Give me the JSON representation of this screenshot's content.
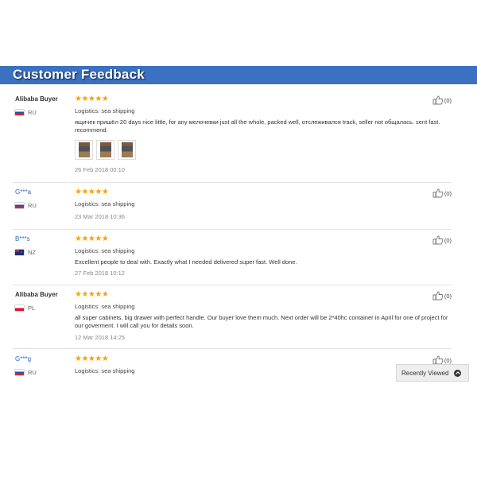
{
  "header": {
    "title": "Customer Feedback"
  },
  "colors": {
    "header_bg": "#3a71c0",
    "star": "#f5a400",
    "masked_name": "#2d6cc6"
  },
  "reviews": [
    {
      "name": "Alibaba Buyer",
      "country": "RU",
      "flag_icon": "flag-ru-icon",
      "stars": "★★★★★",
      "rating": 5,
      "logistics": "Logistics: sea shipping",
      "comment": "ящичек пришёл 20 days nice little, for any мелочевки just all the whole, packed well, отслеживался track, seller not общалась. sent fast. recommend.",
      "photos": 3,
      "date": "26 Feb 2018 00:10",
      "likes": "(0)"
    },
    {
      "name": "G***a",
      "country": "RU",
      "flag_icon": "flag-ru-icon",
      "stars": "★★★★★",
      "rating": 5,
      "logistics": "Logistics: sea shipping",
      "comment": "",
      "date": "23 Mar 2018 10:36",
      "likes": "(0)"
    },
    {
      "name": "B***s",
      "country": "NZ",
      "flag_icon": "flag-nz-icon",
      "stars": "★★★★★",
      "rating": 5,
      "logistics": "Logistics: sea shipping",
      "comment": "Excellent people to deal with. Exactly what I needed delivered super fast. Well done.",
      "date": "27 Feb 2018 10:12",
      "likes": "(0)"
    },
    {
      "name": "Alibaba Buyer",
      "country": "PL",
      "flag_icon": "flag-pl-icon",
      "stars": "★★★★★",
      "rating": 5,
      "logistics": "Logistics: sea shipping",
      "comment": "all super cabinets, big drawer with perfect handle. Our buyer love them much. Next order will be 2*40hc container in April for one of project for our goverment. I will call you for details soon.",
      "date": "12 Mar 2018 14:25",
      "likes": "(0)"
    },
    {
      "name": "G***g",
      "country": "RU",
      "flag_icon": "flag-ru-icon",
      "stars": "★★★★★",
      "rating": 5,
      "logistics": "Logistics: sea shipping",
      "comment": "",
      "date": "",
      "likes": "(0)"
    }
  ],
  "recently_viewed": {
    "label": "Recently Viewed",
    "icon": "chevron-up-icon"
  }
}
